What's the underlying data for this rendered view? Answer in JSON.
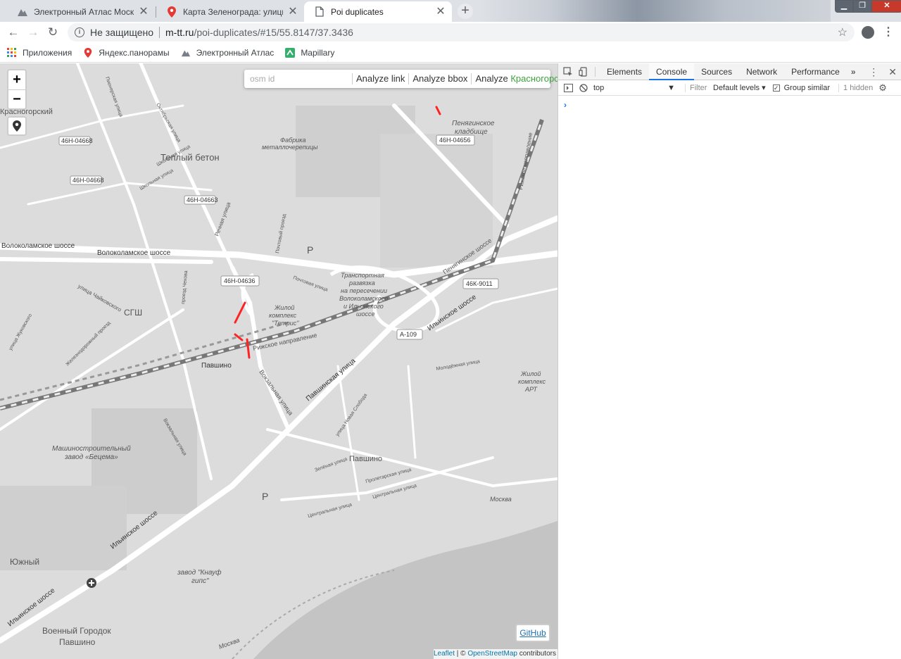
{
  "browser": {
    "tabs": [
      {
        "label": "Электронный Атлас Москвы",
        "icon": "atlas-icon",
        "active": false
      },
      {
        "label": "Карта Зеленограда: улицы, дом",
        "icon": "map-pin-icon",
        "active": false
      },
      {
        "label": "Poi duplicates",
        "icon": "page-icon",
        "active": true
      }
    ],
    "new_tab": "+",
    "close_glyph": "✕",
    "security_label": "Не защищено",
    "url_host": "m-tt.ru",
    "url_path": "/poi-duplicates/#15/55.8147/37.3436",
    "bookmarks": [
      "Приложения",
      "Яндекс.панорамы",
      "Электронный Атлас",
      "Mapillary"
    ]
  },
  "map": {
    "search_placeholder": "osm id",
    "buttons": {
      "analyze_link": "Analyze link",
      "analyze_bbox": "Analyze bbox",
      "analyze_prefix": "Analyze",
      "analyze_city": "Красногорск"
    },
    "zoom_in": "+",
    "zoom_out": "−",
    "github": "GitHub",
    "attribution": {
      "leaflet": "Leaflet",
      "sep": " | © ",
      "osm": "OpenStreetMap",
      "suffix": " contributors"
    },
    "labels": {
      "teply_beton": "Теплый бетон",
      "fabrika": "Фабрика",
      "fabrika2": "металлочерепицы",
      "kladbishe": "Пенягинское",
      "kladbishe2": "кладбище",
      "volokolamskoe": "Волоколамское шоссе",
      "volokolamskoe2": "Волоколамское шоссе",
      "krasnogorsky": "Красногорский",
      "transport": "Транспортная",
      "transport2": "развязка",
      "transport3": "на пересечении",
      "transport4": "Волоколамского",
      "transport5": "и Ильинского",
      "transport6": "шоссе",
      "zhiloy": "Жилой",
      "zhiloy2": "комплекс",
      "zhiloy3": "\"Тетрис\"",
      "rizhskoe": "Рижское направление",
      "pavshino": "Павшино",
      "pavshino2": "Павшино",
      "pavshinskaya": "Павшинская улица",
      "vokzalnaya": "Вокзальная улица",
      "ilinskoe": "Ильинское шоссе",
      "ilinskoe2": "Ильинское шоссе",
      "ilinskoe3": "Ильинское шоссе",
      "penyaginskoe": "Пенягинское шоссе",
      "mashzavod": "Машиностроительный",
      "mashzavod2": "завод «Бецема»",
      "yuzhny": "Южный",
      "voenny": "Военный Городок",
      "voenny2": "Павшино",
      "knauf": "завод \"Кнауф",
      "knauf2": "гипс\"",
      "moskva": "Москва",
      "moskva2": "Москва",
      "zhiloy_art": "Жилой",
      "zhiloy_art2": "комплекс",
      "zhiloy_art3": "АРТ",
      "sgsh": "СГШ",
      "tsentralnaya": "Центральная улица",
      "tsentralnaya2": "Центральная улица",
      "proletarskaya": "Пролетарская улица",
      "zelenaya": "Зелёная улица",
      "molodezhnaya": "Молодёжная улица",
      "pochtovaya": "Почтовая улица",
      "pochtovaya2": "Почтовый проезд",
      "rechnaya": "Речная улица",
      "shkolnaya": "Школьная улица",
      "sholnaya2": "Школьная улица",
      "oktyabrskaya": "Октябрьская улица",
      "pionerskaya": "Пионерская улица",
      "chaikovskogo": "улица Чайковского",
      "chekhova": "проезд Чехова",
      "zhukovskogo": "улица Жуковского",
      "zheleznodorozhny": "Железнодорожный проезд",
      "vokzalnaya2": "Вокзальная улица",
      "novaya": "улица Новая Слобода",
      "rizhskoe2": "Рижское направление",
      "parking": "P",
      "parking2": "P"
    },
    "road_shields": {
      "s1": "46Н-04656",
      "s2": "46Н-04668",
      "s3": "46Н-04668",
      "s4": "46Н-04663",
      "s5": "46Н-04636",
      "s6": "46К-9011",
      "s7": "А-109"
    }
  },
  "devtools": {
    "tabs": [
      "Elements",
      "Console",
      "Sources",
      "Network",
      "Performance"
    ],
    "active_tab": "Console",
    "more": "»",
    "context": "top",
    "filter_placeholder": "Filter",
    "levels": "Default levels",
    "group_similar": "Group similar",
    "hidden": "1 hidden",
    "prompt": "›"
  }
}
